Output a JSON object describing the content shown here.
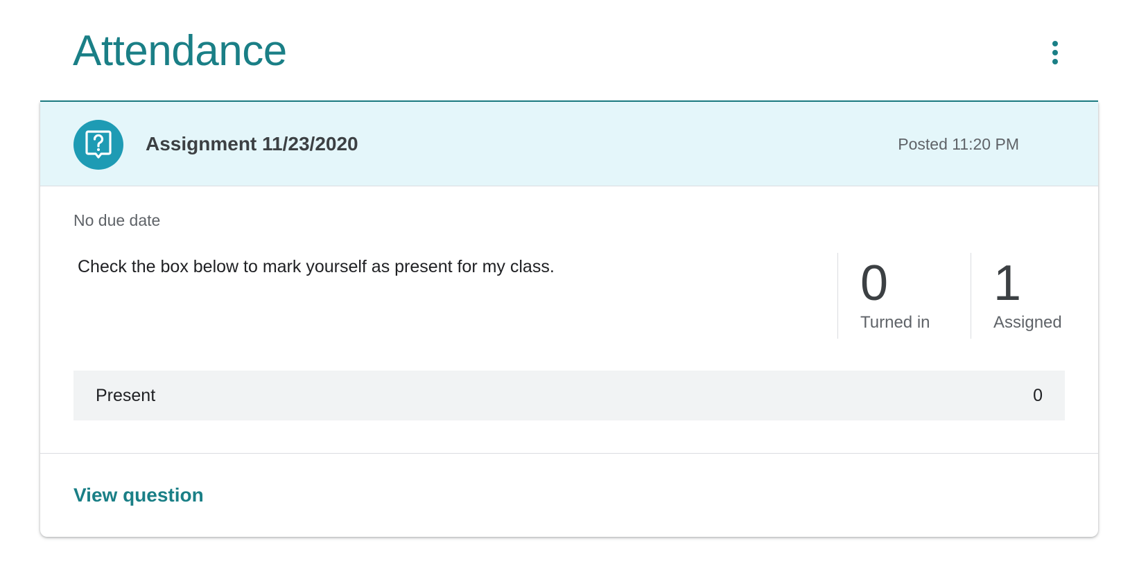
{
  "topic": {
    "title": "Attendance",
    "more_icon": "more-vert-icon"
  },
  "assignment": {
    "icon": "question-answer-icon",
    "title": "Assignment 11/23/2020",
    "posted": "Posted 11:20 PM",
    "due_date": "No due date",
    "description": "Check the box below to mark yourself as present for my class."
  },
  "stats": [
    {
      "value": "0",
      "label": "Turned in"
    },
    {
      "value": "1",
      "label": "Assigned"
    }
  ],
  "answers": [
    {
      "label": "Present",
      "count": "0"
    }
  ],
  "footer": {
    "view_label": "View question"
  },
  "colors": {
    "accent": "#1a7f86",
    "header_bg": "#e4f6fa",
    "icon_bg": "#1e9bb4"
  }
}
